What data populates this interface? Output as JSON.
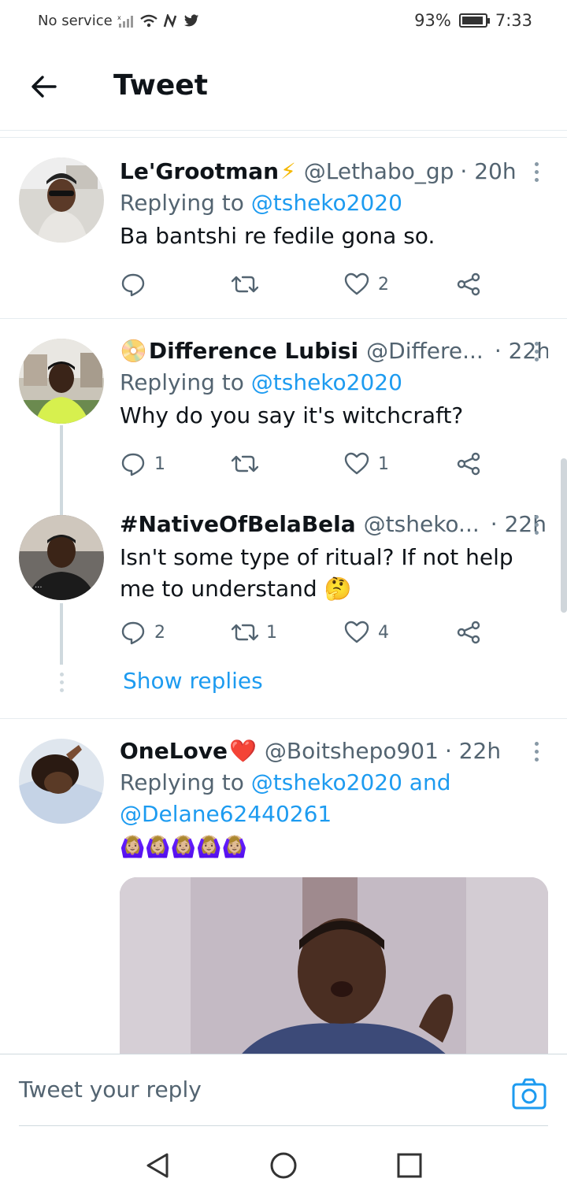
{
  "status_bar": {
    "carrier": "No service",
    "battery": "93%",
    "battery_fraction": 0.93,
    "time": "7:33"
  },
  "header": {
    "title": "Tweet"
  },
  "tweets": [
    {
      "name": "Le'Grootman",
      "name_emoji": "⚡",
      "handle": "@Lethabo_gp",
      "time": "· 20h",
      "replying_prefix": "Replying to",
      "replying_to": "@tsheko2020",
      "text": "Ba bantshi re fedile gona so.",
      "replies": "",
      "retweets": "",
      "likes": "2"
    },
    {
      "name": "Difference Lubisi",
      "name_prefix_emoji": "📀",
      "handle": "@Differe...",
      "time": "· 22h",
      "replying_prefix": "Replying to",
      "replying_to": "@tsheko2020",
      "text": "Why do you say it's witchcraft?",
      "replies": "1",
      "retweets": "",
      "likes": "1"
    },
    {
      "name": "#NativeOfBelaBela",
      "handle": "@tsheko...",
      "time": "· 22h",
      "text": "Isn't some type of ritual? If not help me to understand 🤔",
      "replies": "2",
      "retweets": "1",
      "likes": "4"
    },
    {
      "name": "OneLove",
      "name_emoji": "❤️",
      "handle": "@Boitshepo901",
      "time": "· 22h",
      "replying_prefix": "Replying to",
      "replying_to": "@tsheko2020 and @Delane62440261",
      "text": "🙆🏼‍♀️🙆🏼‍♀️🙆🏼‍♀️🙆🏼‍♀️🙆🏼‍♀️"
    }
  ],
  "show_replies": "Show replies",
  "compose": {
    "placeholder": "Tweet your reply"
  },
  "colors": {
    "accent": "#1d9bf0",
    "text": "#0f1419",
    "muted": "#536471"
  }
}
